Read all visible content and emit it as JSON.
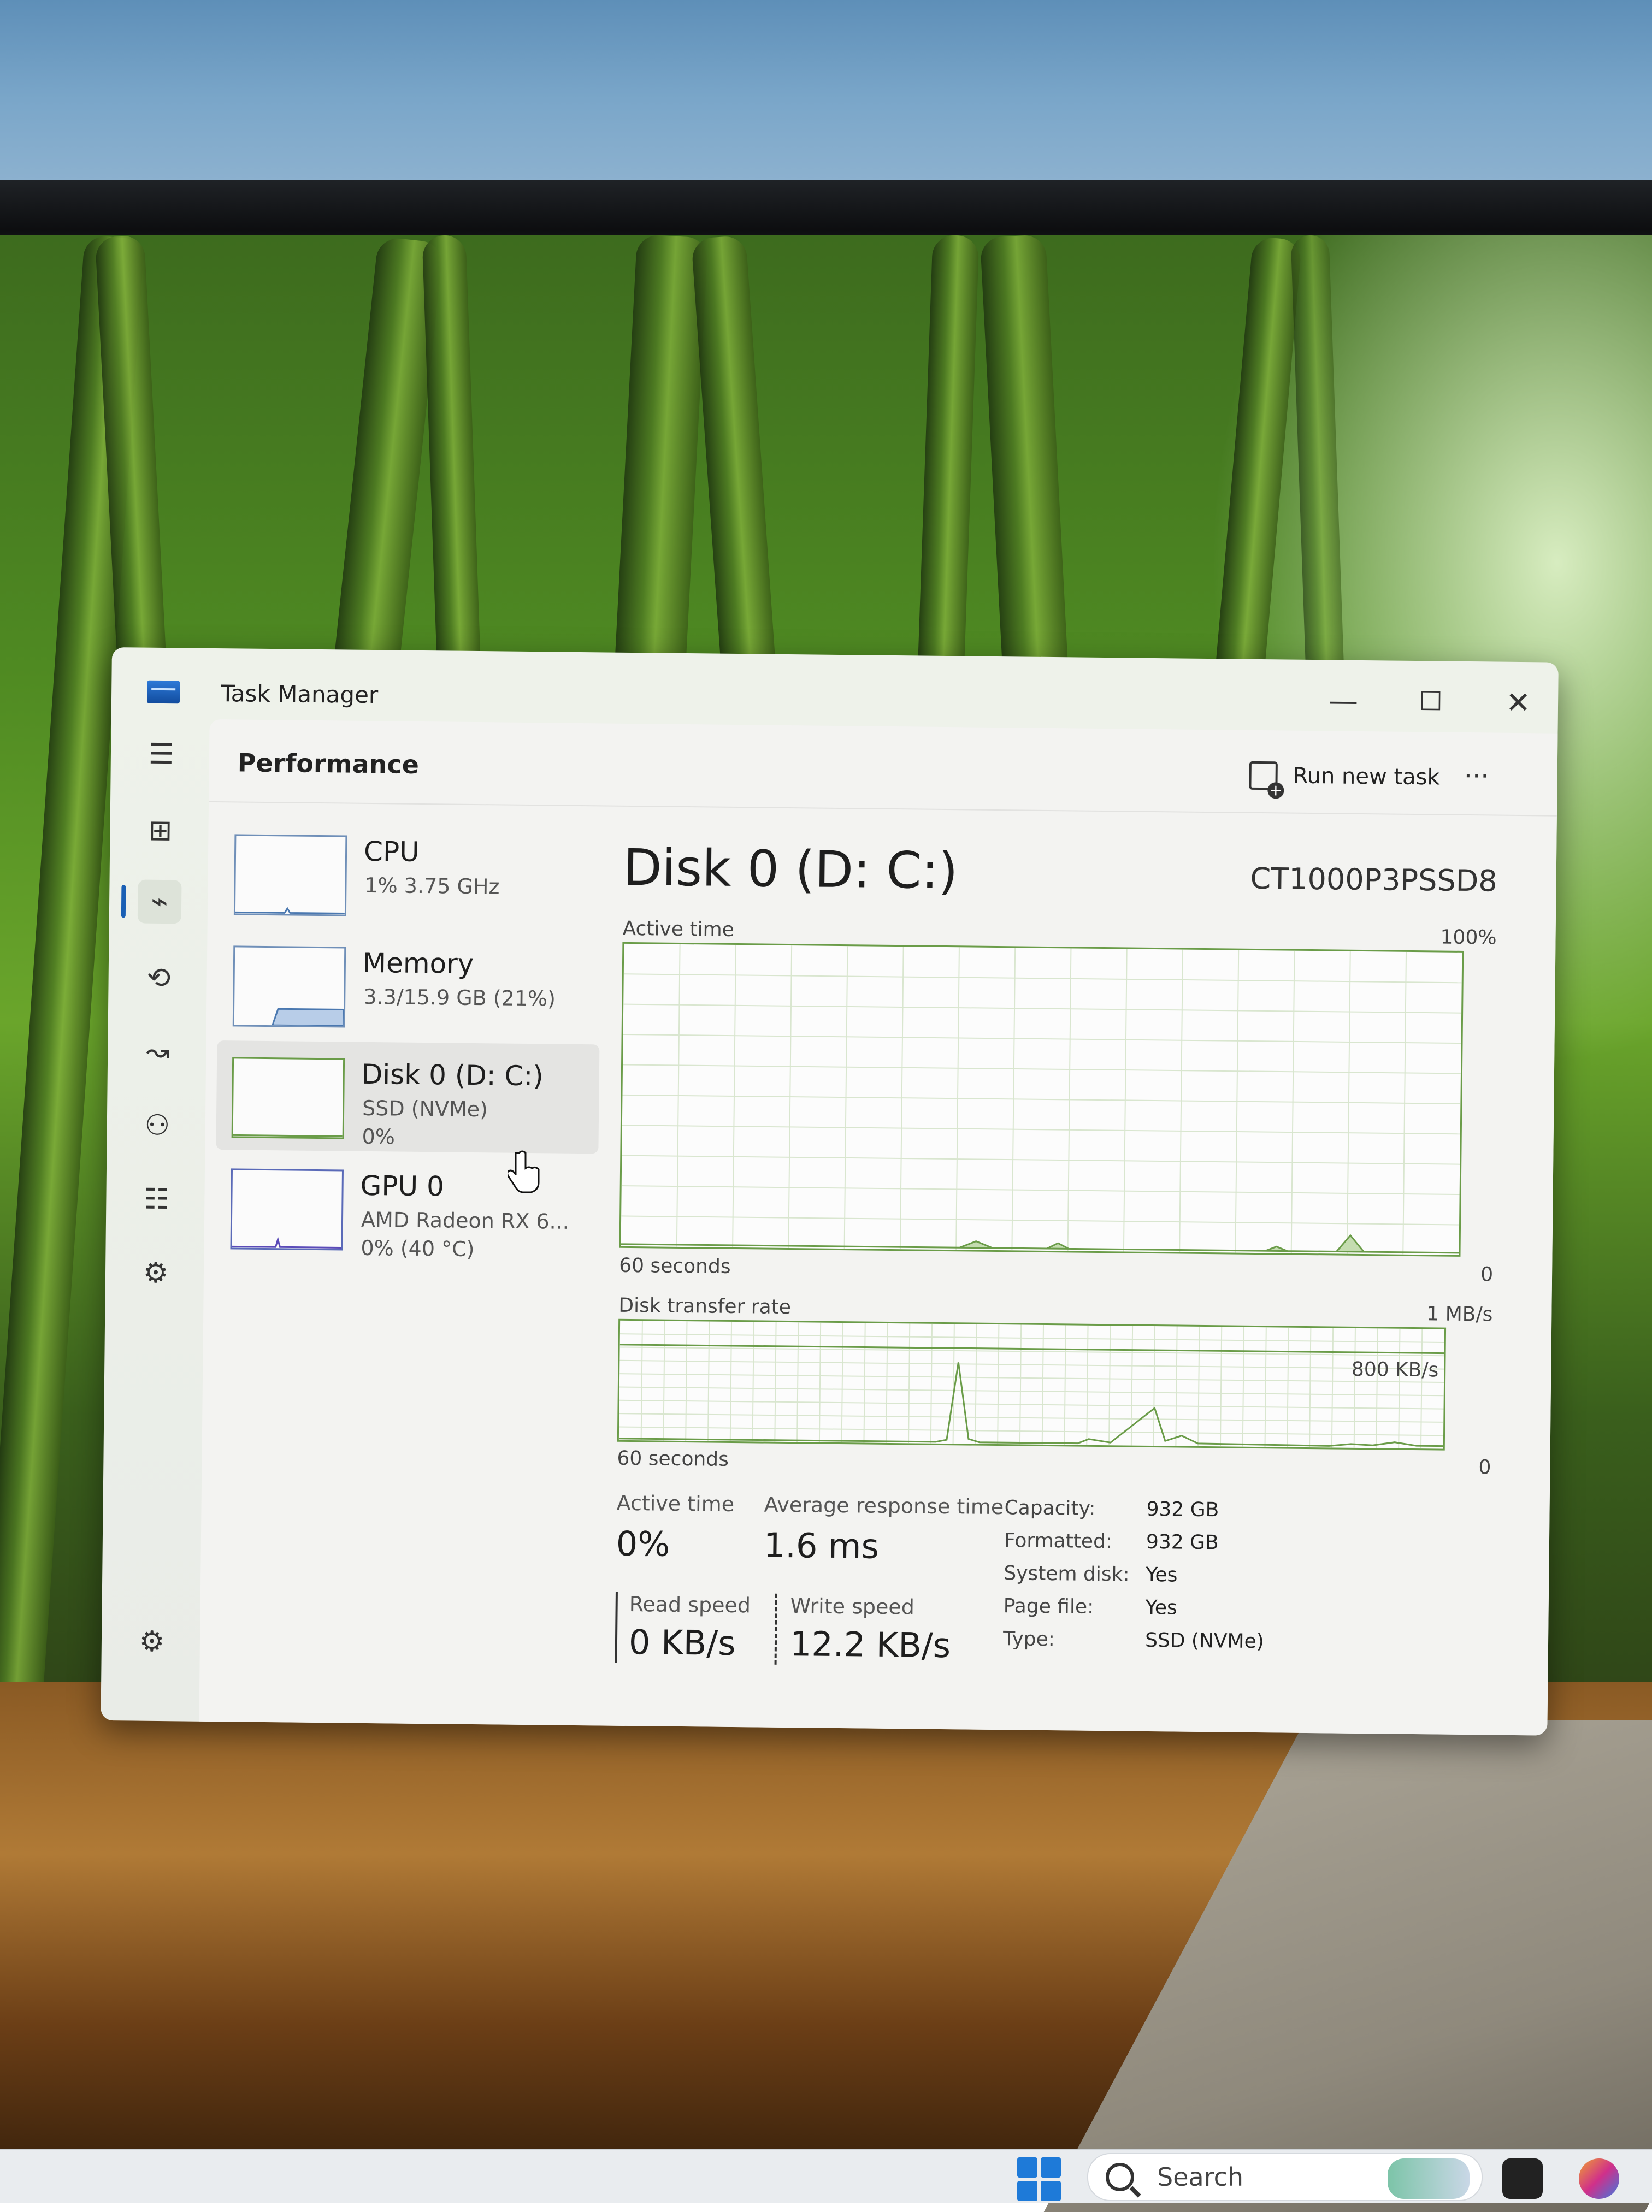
{
  "window": {
    "title": "Task Manager"
  },
  "header": {
    "title": "Performance",
    "run_new_task": "Run new task",
    "more": "···"
  },
  "window_controls": {
    "minimize": "—",
    "maximize": "☐",
    "close": "✕"
  },
  "nav": {
    "menu": "☰",
    "processes": "⊞",
    "performance": "⌁",
    "app_history": "⟲",
    "startup": "↝",
    "users": "⚇",
    "details": "☷",
    "services": "⚙",
    "settings": "⚙"
  },
  "resources": [
    {
      "name": "CPU",
      "sub1": "1% 3.75 GHz",
      "sub2": "",
      "sub3": ""
    },
    {
      "name": "Memory",
      "sub1": "3.3/15.9 GB (21%)",
      "sub2": "",
      "sub3": ""
    },
    {
      "name": "Disk 0 (D: C:)",
      "sub1": "SSD (NVMe)",
      "sub2": "0%",
      "sub3": ""
    },
    {
      "name": "GPU 0",
      "sub1": "AMD Radeon RX 6...",
      "sub2": "0% (40 °C)",
      "sub3": ""
    }
  ],
  "detail": {
    "title": "Disk 0 (D: C:)",
    "model": "CT1000P3PSSD8",
    "active_time_graph": {
      "label": "Active time",
      "max": "100%",
      "span": "60 seconds",
      "min": "0"
    },
    "transfer_graph": {
      "label": "Disk transfer rate",
      "max": "1 MB/s",
      "line_label": "800 KB/s",
      "span": "60 seconds",
      "min": "0"
    },
    "stats": {
      "active_time_label": "Active time",
      "active_time": "0%",
      "avg_response_label": "Average response time",
      "avg_response": "1.6 ms",
      "read_label": "Read speed",
      "read": "0 KB/s",
      "write_label": "Write speed",
      "write": "12.2 KB/s"
    },
    "props": [
      {
        "k": "Capacity:",
        "v": "932 GB"
      },
      {
        "k": "Formatted:",
        "v": "932 GB"
      },
      {
        "k": "System disk:",
        "v": "Yes"
      },
      {
        "k": "Page file:",
        "v": "Yes"
      },
      {
        "k": "Type:",
        "v": "SSD (NVMe)"
      }
    ]
  },
  "taskbar": {
    "search": "Search"
  },
  "colors": {
    "accent": "#1a5fb4",
    "disk_graph": "#6aa84f",
    "graph_border": "#6a6a6a"
  }
}
